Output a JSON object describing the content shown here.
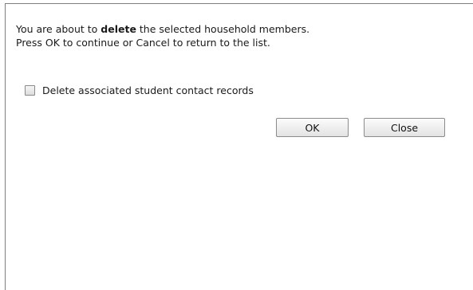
{
  "dialog": {
    "message_line1_prefix": "You are about to ",
    "message_line1_bold": "delete",
    "message_line1_suffix": " the selected household members.",
    "message_line2": "Press OK to continue or Cancel to return to the list.",
    "checkbox_label": "Delete associated student contact records",
    "checkbox_checked": false,
    "ok_label": "OK",
    "close_label": "Close"
  }
}
